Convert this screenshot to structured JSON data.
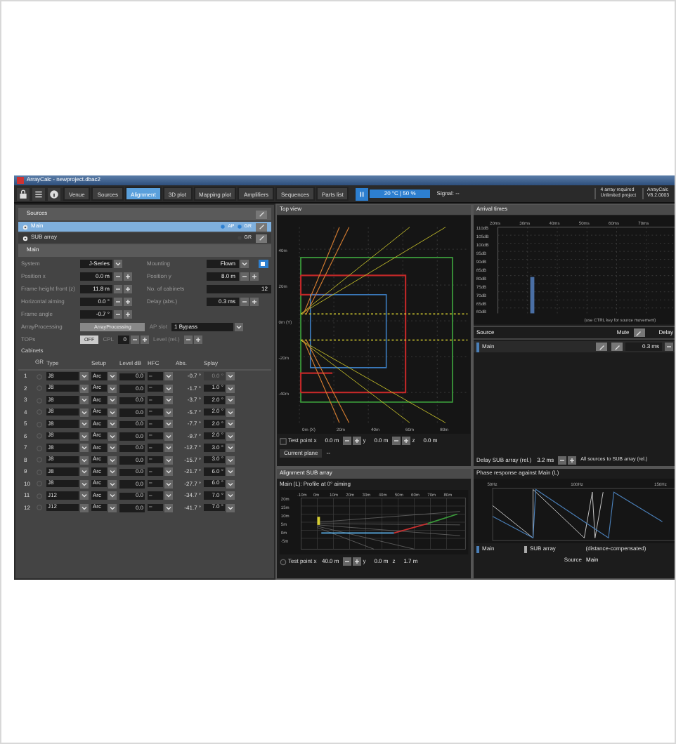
{
  "window": {
    "title": "ArrayCalc - newproject.dbac2"
  },
  "toolbar": {
    "tabs": [
      {
        "label": "Venue",
        "selected": false
      },
      {
        "label": "Sources",
        "selected": false
      },
      {
        "label": "Alignment",
        "selected": true
      },
      {
        "label": "3D plot",
        "selected": false
      },
      {
        "label": "Mapping plot",
        "selected": false
      },
      {
        "label": "Amplifiers",
        "selected": false
      },
      {
        "label": "Sequences",
        "selected": false
      },
      {
        "label": "Parts list",
        "selected": false
      }
    ],
    "climate": "20 °C | 50 %",
    "signal": "Signal: --",
    "license": [
      "4 array required",
      "Unlimited project"
    ],
    "version": [
      "ArrayCalc",
      "V8.2.0003"
    ]
  },
  "sources": {
    "title": "Sources",
    "items": [
      {
        "name": "Main",
        "selected": true,
        "tags": [
          "AP",
          "GR"
        ]
      },
      {
        "name": "SUB array",
        "selected": false,
        "tags": [
          "GR"
        ]
      }
    ]
  },
  "main": {
    "title": "Main",
    "field_rows": [
      [
        {
          "label": "System",
          "value": "J-Series",
          "kind": "select"
        },
        {
          "label": "Mounting",
          "value": "Flown",
          "kind": "select-icon"
        }
      ],
      [
        {
          "label": "Position x",
          "value": "0.0 m",
          "kind": "stepper"
        },
        {
          "label": "Position y",
          "value": "8.0 m",
          "kind": "stepper"
        }
      ],
      [
        {
          "label": "Frame height front (z)",
          "value": "11.8 m",
          "kind": "stepper"
        },
        {
          "label": "No. of cabinets",
          "value": "12",
          "kind": "readonly"
        }
      ],
      [
        {
          "label": "Horizontal aiming",
          "value": "0.0 °",
          "kind": "stepper"
        },
        {
          "label": "Delay (abs.)",
          "value": "0.3 ms",
          "kind": "stepper"
        }
      ],
      [
        {
          "label": "Frame angle",
          "value": "-0.7 °",
          "kind": "stepper"
        }
      ]
    ],
    "processing": {
      "label": "ArrayProcessing",
      "button": "ArrayProcessing",
      "slot_label": "AP slot",
      "slot": "1 Bypass"
    },
    "tops": {
      "label": "TOPs",
      "button": "OFF",
      "cpl_label": "CPL",
      "cpl": "0",
      "level_label": "Level (rel.)"
    }
  },
  "cabinets": {
    "title": "Cabinets",
    "columns": [
      "GR",
      "Type",
      "Setup",
      "Level dB",
      "HFC",
      "Abs.",
      "Splay"
    ],
    "rows": [
      {
        "n": "1",
        "type": "J8",
        "setup": "Arc",
        "level": "0.0",
        "hfc": "–",
        "abs": "-0.7 °",
        "splay": "0.0 °",
        "splay_disabled": true,
        "gr": false
      },
      {
        "n": "2",
        "type": "J8",
        "setup": "Arc",
        "level": "0.0",
        "hfc": "–",
        "abs": "-1.7 °",
        "splay": "1.0 °",
        "splay_disabled": false,
        "gr": false
      },
      {
        "n": "3",
        "type": "J8",
        "setup": "Arc",
        "level": "0.0",
        "hfc": "–",
        "abs": "-3.7 °",
        "splay": "2.0 °",
        "splay_disabled": false,
        "gr": false
      },
      {
        "n": "4",
        "type": "J8",
        "setup": "Arc",
        "level": "0.0",
        "hfc": "–",
        "abs": "-5.7 °",
        "splay": "2.0 °",
        "splay_disabled": false,
        "gr": false
      },
      {
        "n": "5",
        "type": "J8",
        "setup": "Arc",
        "level": "0.0",
        "hfc": "–",
        "abs": "-7.7 °",
        "splay": "2.0 °",
        "splay_disabled": false,
        "gr": false
      },
      {
        "n": "6",
        "type": "J8",
        "setup": "Arc",
        "level": "0.0",
        "hfc": "–",
        "abs": "-9.7 °",
        "splay": "2.0 °",
        "splay_disabled": false,
        "gr": false
      },
      {
        "n": "7",
        "type": "J8",
        "setup": "Arc",
        "level": "0.0",
        "hfc": "–",
        "abs": "-12.7 °",
        "splay": "3.0 °",
        "splay_disabled": false,
        "gr": false
      },
      {
        "n": "8",
        "type": "J8",
        "setup": "Arc",
        "level": "0.0",
        "hfc": "–",
        "abs": "-15.7 °",
        "splay": "3.0 °",
        "splay_disabled": false,
        "gr": false
      },
      {
        "n": "9",
        "type": "J8",
        "setup": "Arc",
        "level": "0.0",
        "hfc": "–",
        "abs": "-21.7 °",
        "splay": "6.0 °",
        "splay_disabled": false,
        "gr": false
      },
      {
        "n": "10",
        "type": "J8",
        "setup": "Arc",
        "level": "0.0",
        "hfc": "–",
        "abs": "-27.7 °",
        "splay": "6.0 °",
        "splay_disabled": false,
        "gr": false
      },
      {
        "n": "11",
        "type": "J12",
        "setup": "Arc",
        "level": "0.0",
        "hfc": "–",
        "abs": "-34.7 °",
        "splay": "7.0 °",
        "splay_disabled": false,
        "gr": false
      },
      {
        "n": "12",
        "type": "J12",
        "setup": "Arc",
        "level": "0.0",
        "hfc": "–",
        "abs": "-41.7 °",
        "splay": "7.0 °",
        "splay_disabled": false,
        "gr": false
      }
    ]
  },
  "top_view": {
    "title": "Top view",
    "y_labels": [
      "40m",
      "20m",
      "0m (Y)",
      "-20m",
      "-40m"
    ],
    "x_labels": [
      "0m (X)",
      "20m",
      "40m",
      "60m",
      "80m"
    ],
    "test_point": {
      "checked": false,
      "label": "Test point x",
      "x": "0.0 m",
      "y_label": "y",
      "y": "0.0 m",
      "z_label": "z",
      "z": "0.0 m"
    },
    "plane_label": "Current plane",
    "plane": "--"
  },
  "arrival": {
    "title": "Arrival times",
    "y_labels": [
      "110dB",
      "105dB",
      "100dB",
      "95dB",
      "90dB",
      "85dB",
      "80dB",
      "75dB",
      "70dB",
      "65dB",
      "60dB"
    ],
    "x_labels": [
      "20ms",
      "30ms",
      "40ms",
      "50ms",
      "60ms",
      "70ms"
    ],
    "hint": "(use CTRL key for source movement)",
    "columns": [
      "Source",
      "Mute",
      "Delay"
    ],
    "rows": [
      {
        "name": "Main",
        "delay": "0.3 ms"
      }
    ],
    "sub_delay_label": "Delay SUB array (rel.)",
    "sub_delay": "3.2 ms",
    "all_sources": "All sources to SUB array (rel.)"
  },
  "alignment": {
    "title": "Alignment SUB array",
    "subtitle": "Main (L): Profile at 0° aiming",
    "y_labels": [
      "20m",
      "15m",
      "10m",
      "5m",
      "0m",
      "-5m"
    ],
    "x_labels": [
      "-10m",
      "0m",
      "10m",
      "20m",
      "30m",
      "40m",
      "50m",
      "60m",
      "70m",
      "80m"
    ],
    "test_point": {
      "selected": false,
      "label": "Test point x",
      "x": "40.0 m",
      "y_label": "y",
      "y": "0.0 m",
      "z_label": "z",
      "z": "1.7 m"
    }
  },
  "phase": {
    "title": "Phase response against Main (L)",
    "x_labels": [
      "50Hz",
      "100Hz",
      "150Hz"
    ],
    "legend": [
      "Main",
      "SUB array",
      "(distance-compensated)"
    ],
    "source_label": "Source",
    "source": "Main"
  }
}
